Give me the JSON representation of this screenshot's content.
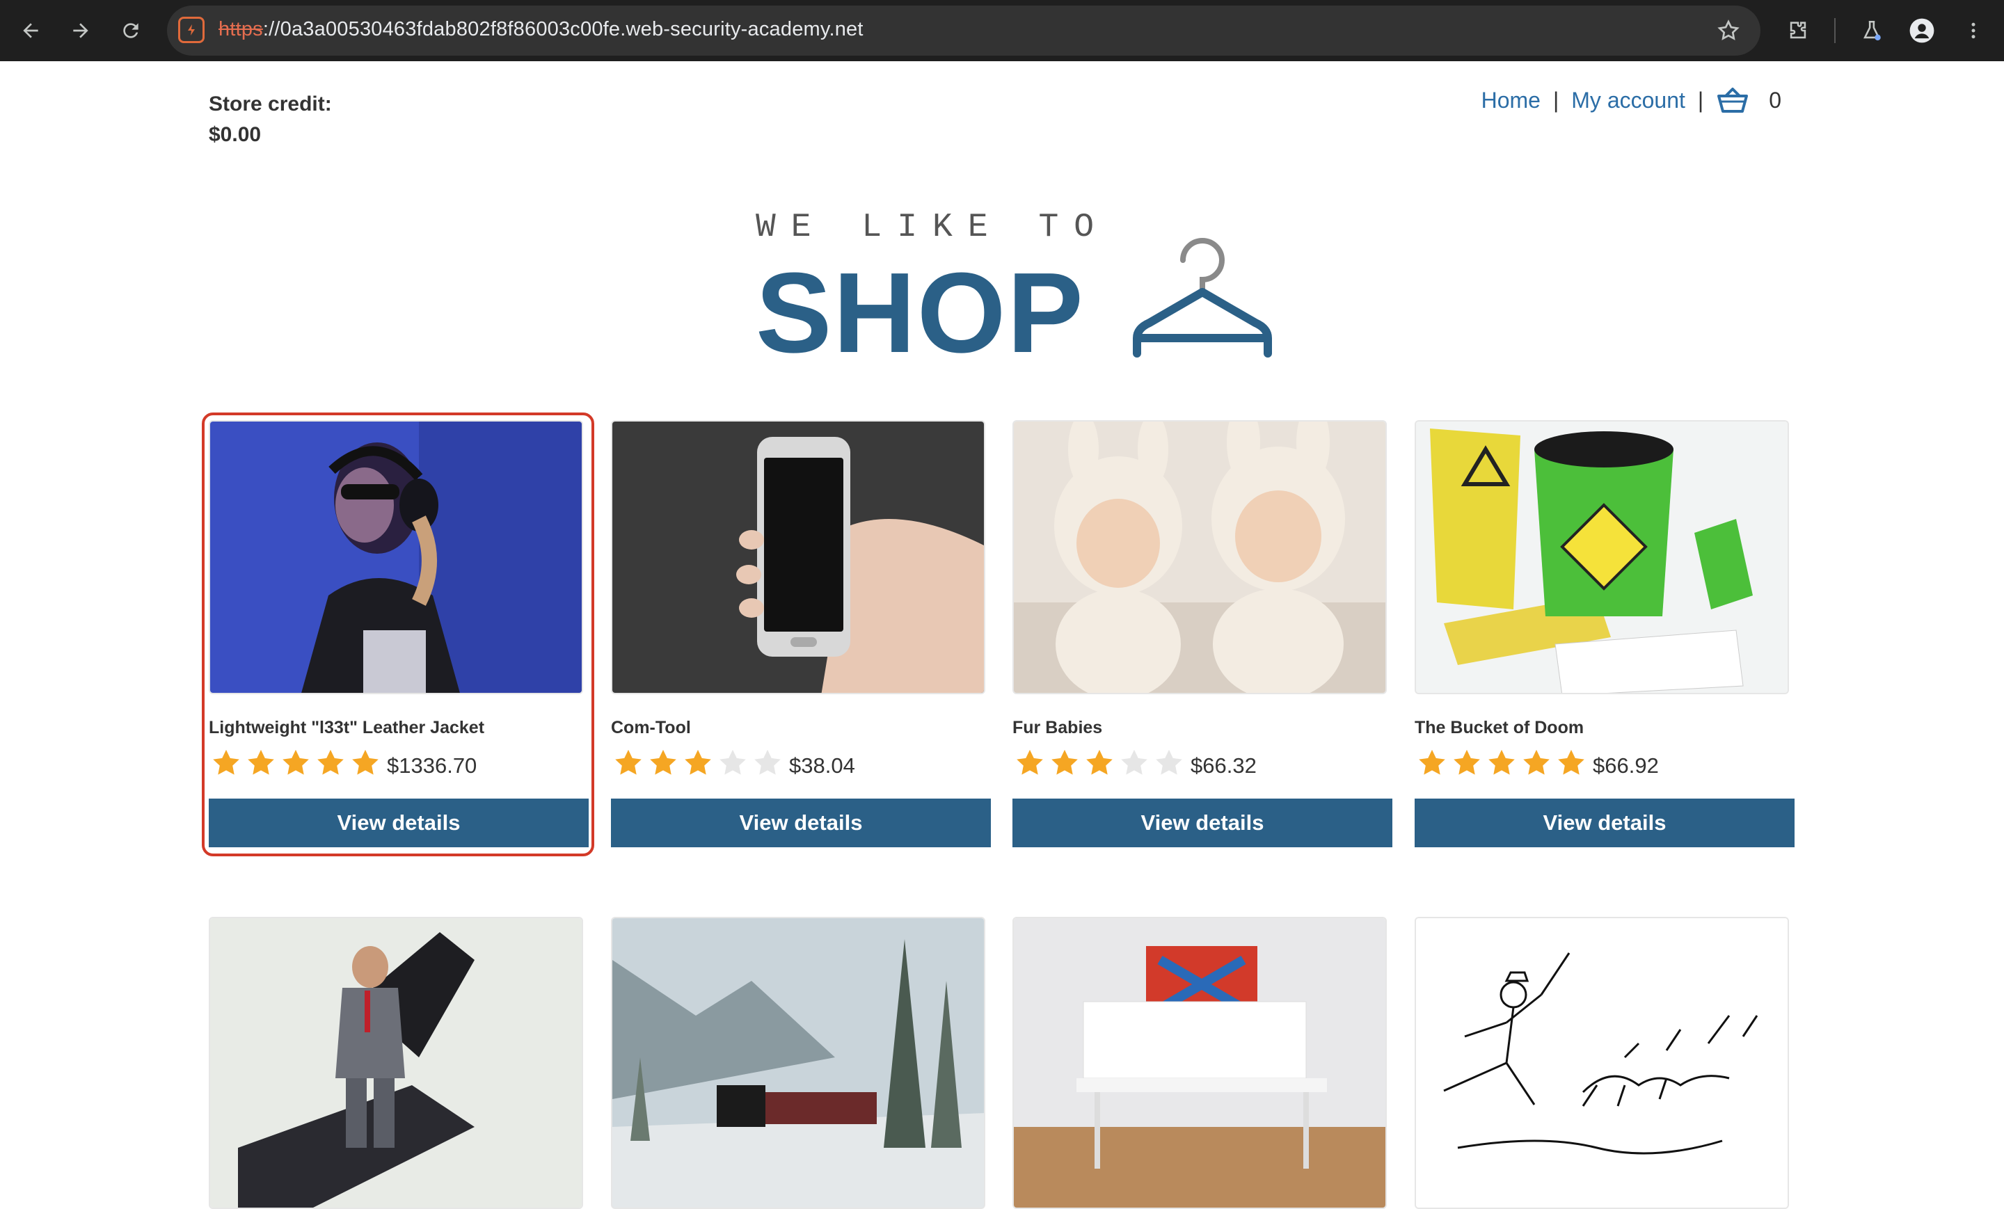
{
  "browser": {
    "url_scheme": "https",
    "url_rest": "://0a3a00530463fdab802f8f86003c00fe.web-security-academy.net"
  },
  "header": {
    "store_credit_label": "Store credit:",
    "store_credit_value": "$0.00",
    "nav_home": "Home",
    "nav_separator": "|",
    "nav_account": "My account",
    "cart_count": "0"
  },
  "logo": {
    "tagline": "WE LIKE TO",
    "word": "SHOP"
  },
  "products": [
    {
      "name": "Lightweight \"l33t\" Leather Jacket",
      "rating": 5,
      "price": "$1336.70",
      "button": "View details"
    },
    {
      "name": "Com-Tool",
      "rating": 3,
      "price": "$38.04",
      "button": "View details"
    },
    {
      "name": "Fur Babies",
      "rating": 3,
      "price": "$66.32",
      "button": "View details"
    },
    {
      "name": "The Bucket of Doom",
      "rating": 5,
      "price": "$66.92",
      "button": "View details"
    }
  ],
  "colors": {
    "accent": "#2b6087",
    "link": "#2b6da6",
    "star_on": "#f5a623",
    "star_off": "#e6e6e6",
    "highlight": "#d33a28"
  }
}
